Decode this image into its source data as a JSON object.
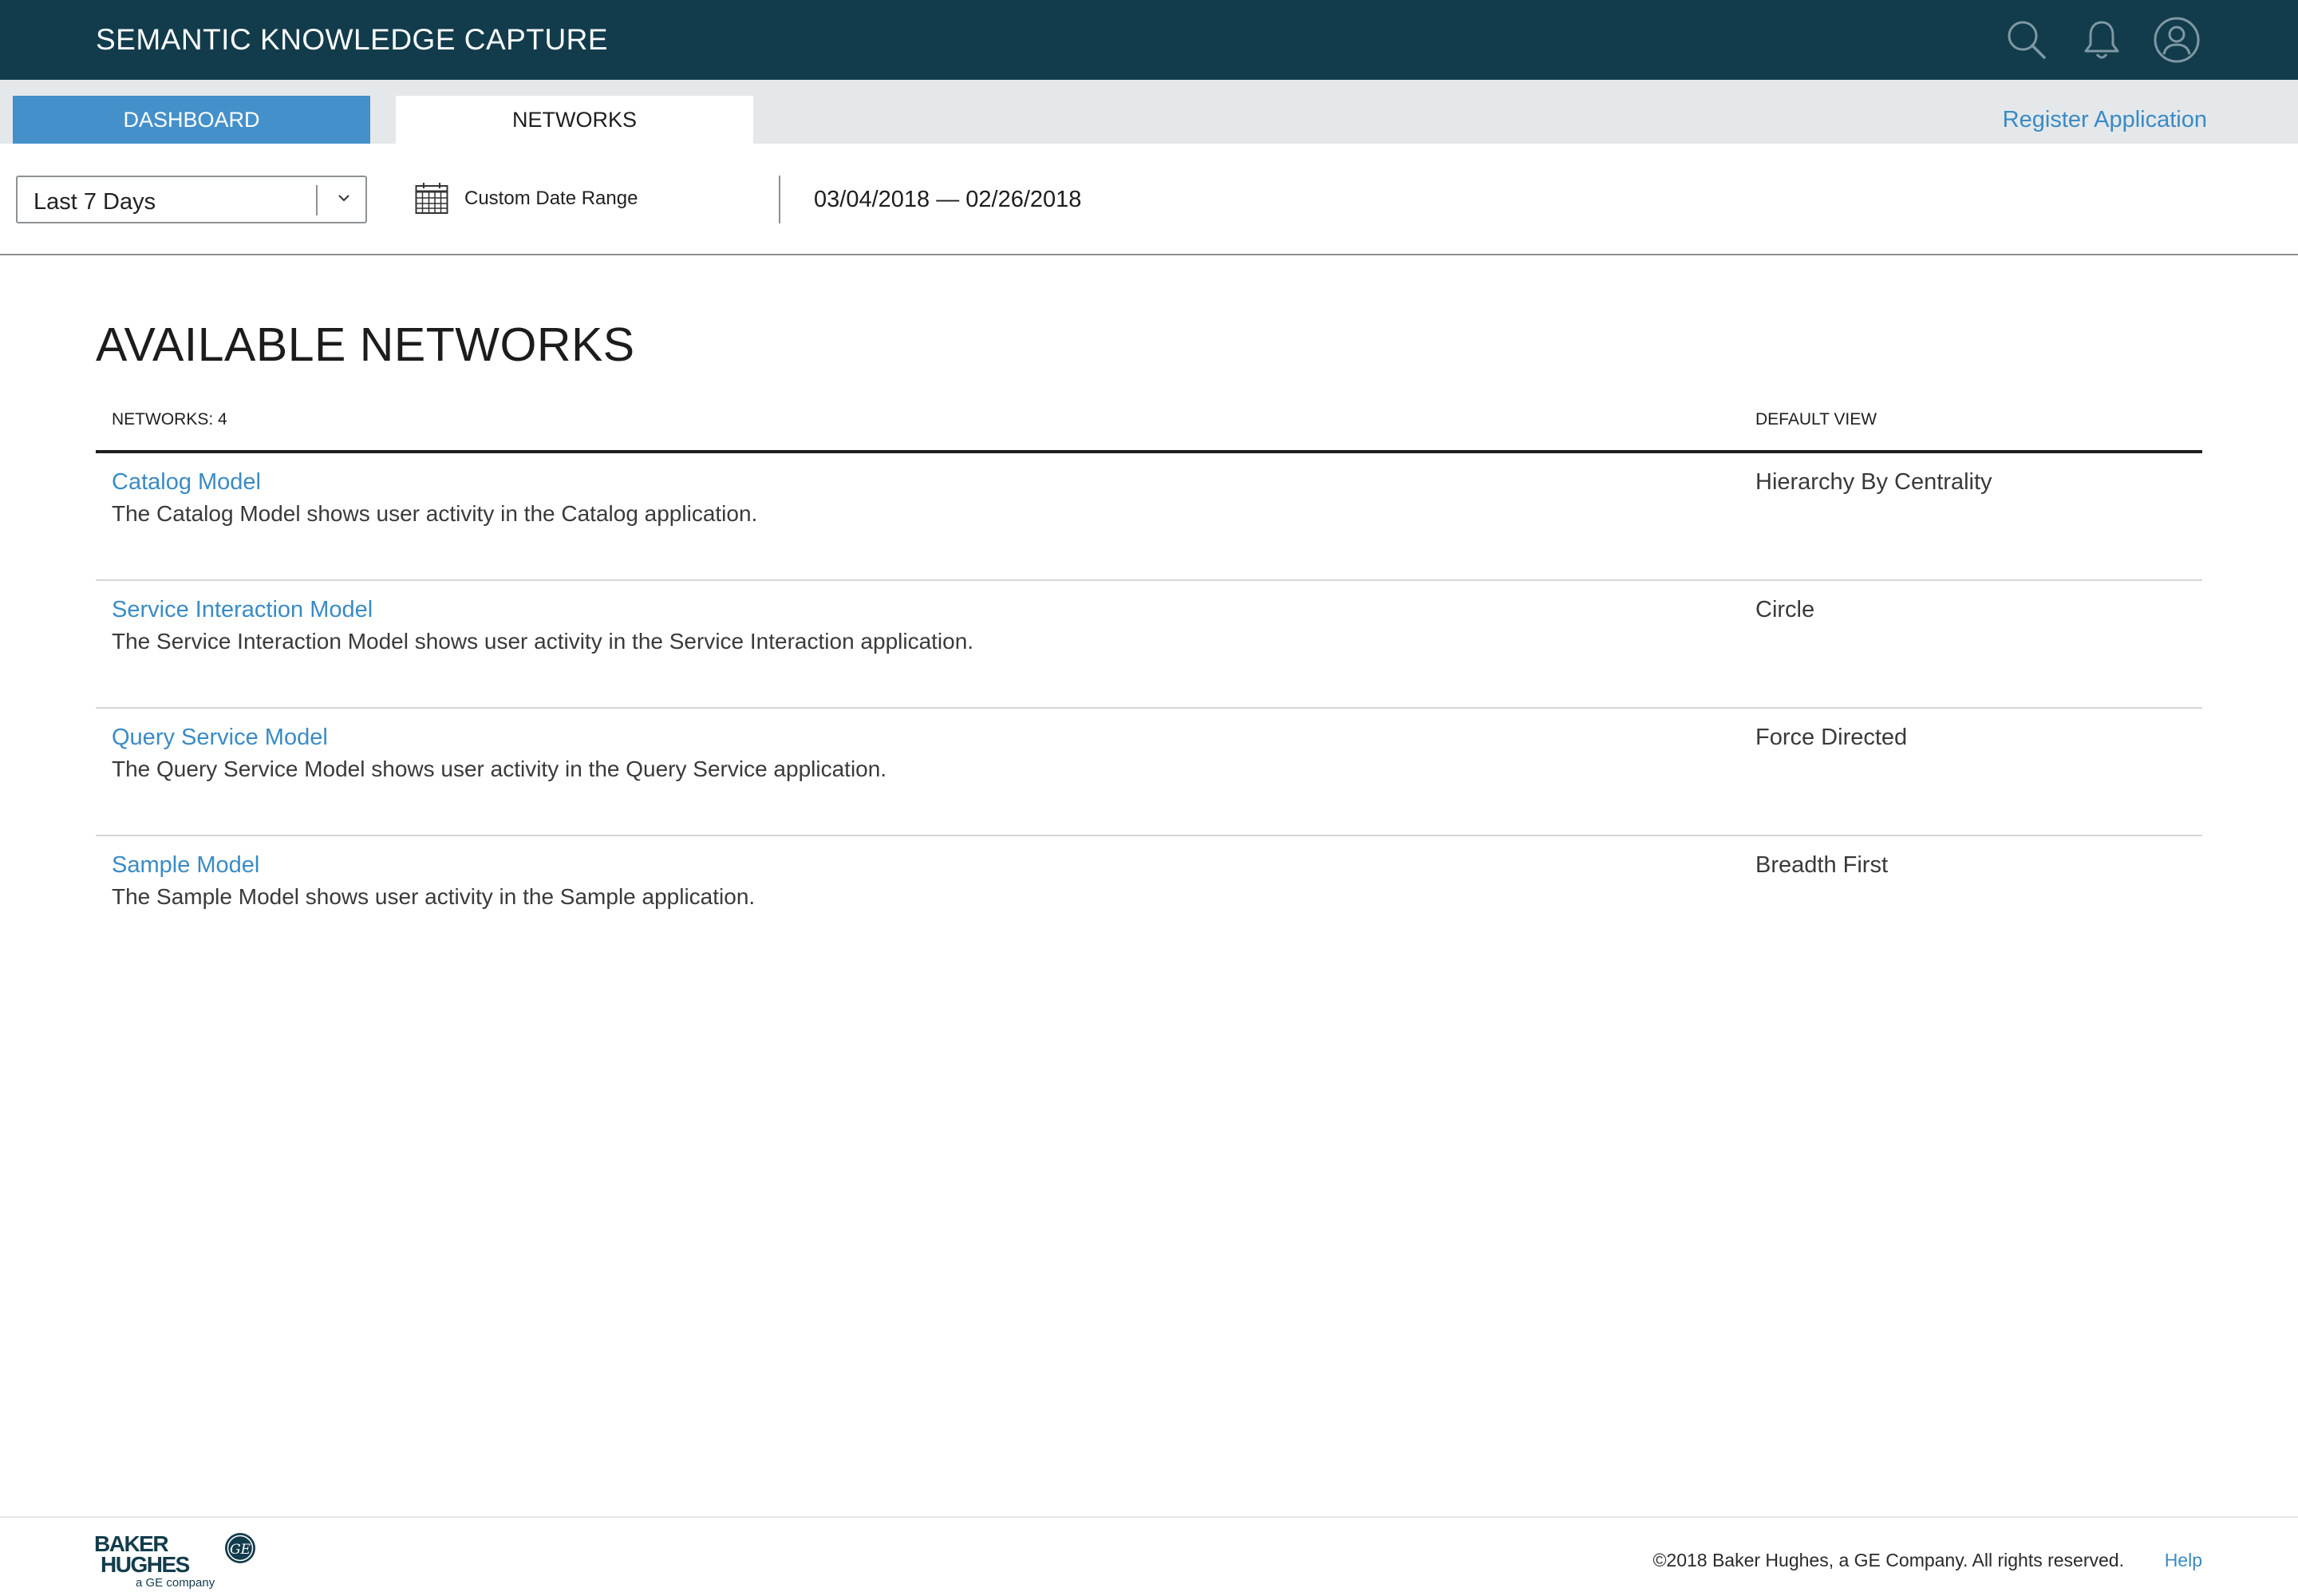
{
  "header": {
    "app_title": "SEMANTIC KNOWLEDGE CAPTURE",
    "icons": [
      "search-icon",
      "bell-icon",
      "user-avatar-icon"
    ]
  },
  "tabs": [
    {
      "label": "DASHBOARD",
      "active": false
    },
    {
      "label": "NETWORKS",
      "active": true
    }
  ],
  "register_link": "Register Application",
  "filters": {
    "range_select": {
      "value": "Last 7 Days"
    },
    "custom_range_label": "Custom Date Range",
    "date_range": "03/04/2018 — 02/26/2018"
  },
  "main": {
    "title": "AVAILABLE NETWORKS",
    "table": {
      "count_label": "NETWORKS: 4",
      "default_view_header": "DEFAULT VIEW",
      "rows": [
        {
          "name": "Catalog Model",
          "description": "The Catalog Model shows user activity in the Catalog application.",
          "default_view": "Hierarchy By Centrality"
        },
        {
          "name": "Service Interaction Model",
          "description": "The Service Interaction Model shows user activity in the Service Interaction application.",
          "default_view": "Circle"
        },
        {
          "name": "Query Service Model",
          "description": "The Query Service Model shows user activity in the Query Service application.",
          "default_view": "Force Directed"
        },
        {
          "name": "Sample Model",
          "description": "The Sample Model shows user activity in the Sample application.",
          "default_view": "Breadth First"
        }
      ]
    }
  },
  "footer": {
    "logo": {
      "line1": "BAKER",
      "line2": "HUGHES",
      "line3": "a GE company",
      "badge": "GE"
    },
    "copyright": "©2018 Baker Hughes, a GE Company. All rights reserved.",
    "help": "Help"
  },
  "colors": {
    "header_bg": "#123c4c",
    "tab_active_bg": "#4490cb",
    "link": "#3a8bc4",
    "tabbar_bg": "#e4e8eb"
  }
}
